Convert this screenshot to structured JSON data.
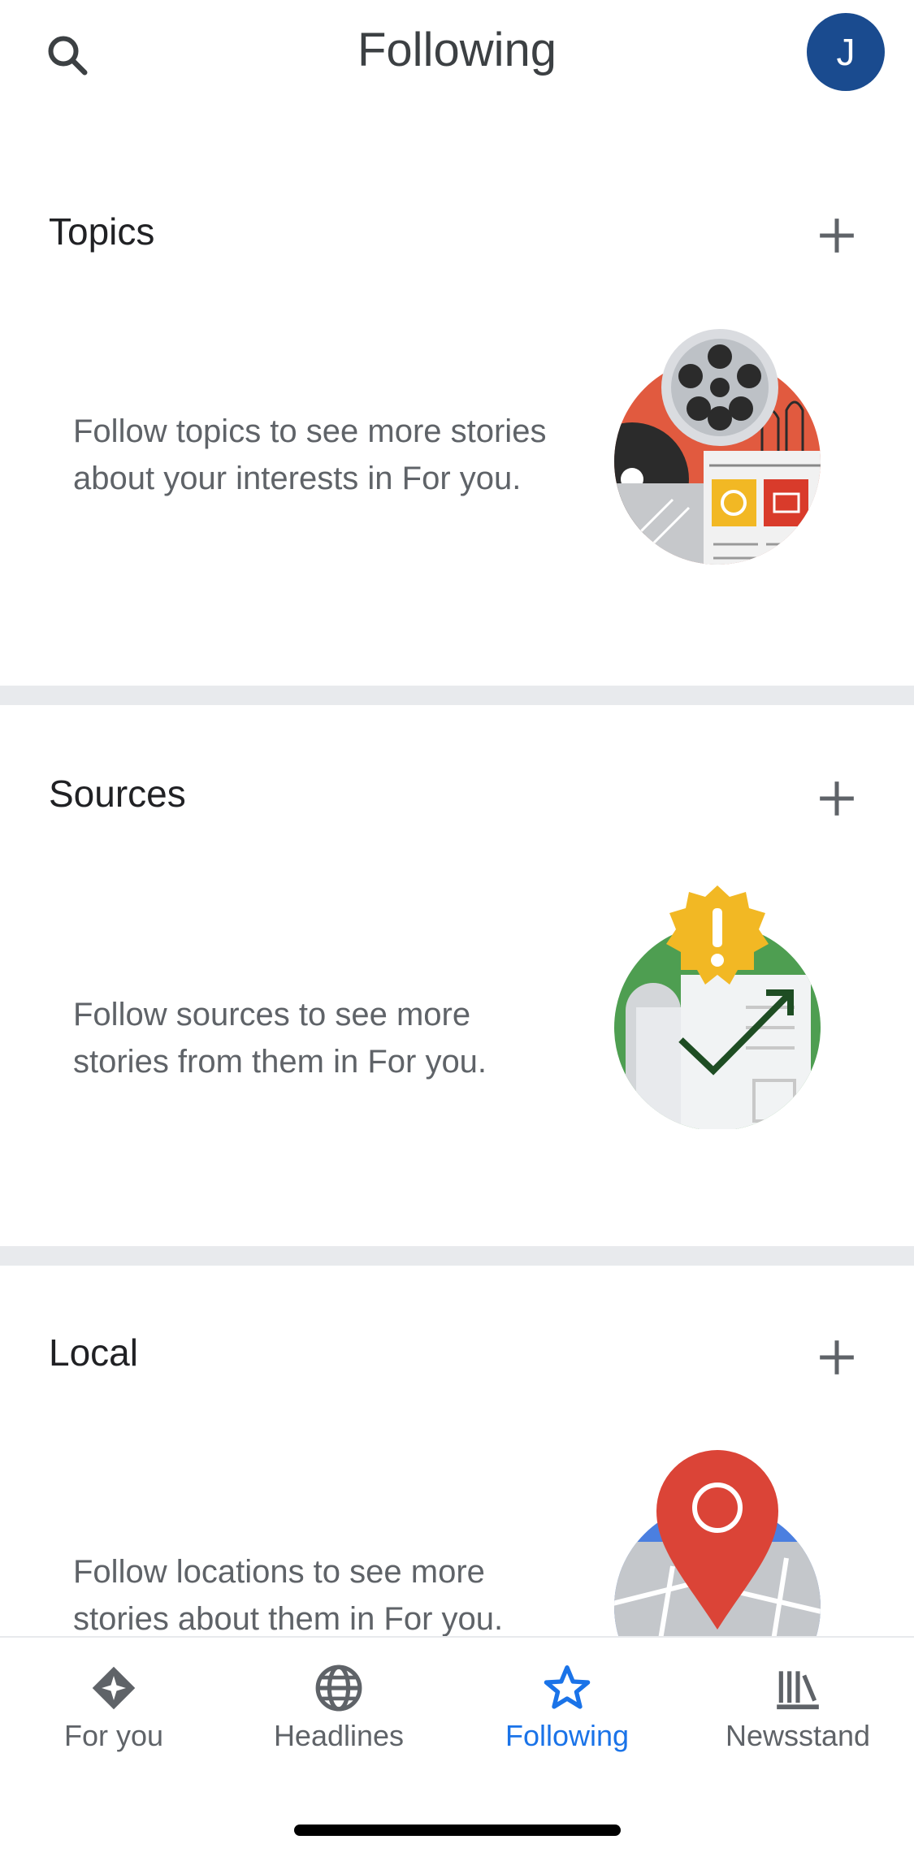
{
  "header": {
    "title": "Following",
    "avatar_initial": "J",
    "search_icon": "search-icon"
  },
  "sections": [
    {
      "title": "Topics",
      "description": "Follow topics to see more stories about your interests in For you.",
      "add_icon": "plus-icon"
    },
    {
      "title": "Sources",
      "description": "Follow sources to see more stories from them in For you.",
      "add_icon": "plus-icon"
    },
    {
      "title": "Local",
      "description": "Follow locations to see more stories about them in For you.",
      "add_icon": "plus-icon"
    }
  ],
  "bottom_nav": {
    "items": [
      {
        "label": "For you",
        "icon": "diamond-star-icon",
        "active": false
      },
      {
        "label": "Headlines",
        "icon": "globe-icon",
        "active": false
      },
      {
        "label": "Following",
        "icon": "star-icon",
        "active": true
      },
      {
        "label": "Newsstand",
        "icon": "newsstand-icon",
        "active": false
      }
    ]
  },
  "colors": {
    "accent": "#1a73e8",
    "avatar": "#1a4b8f",
    "divider": "#e8eaed",
    "text_secondary": "#5f6368"
  }
}
